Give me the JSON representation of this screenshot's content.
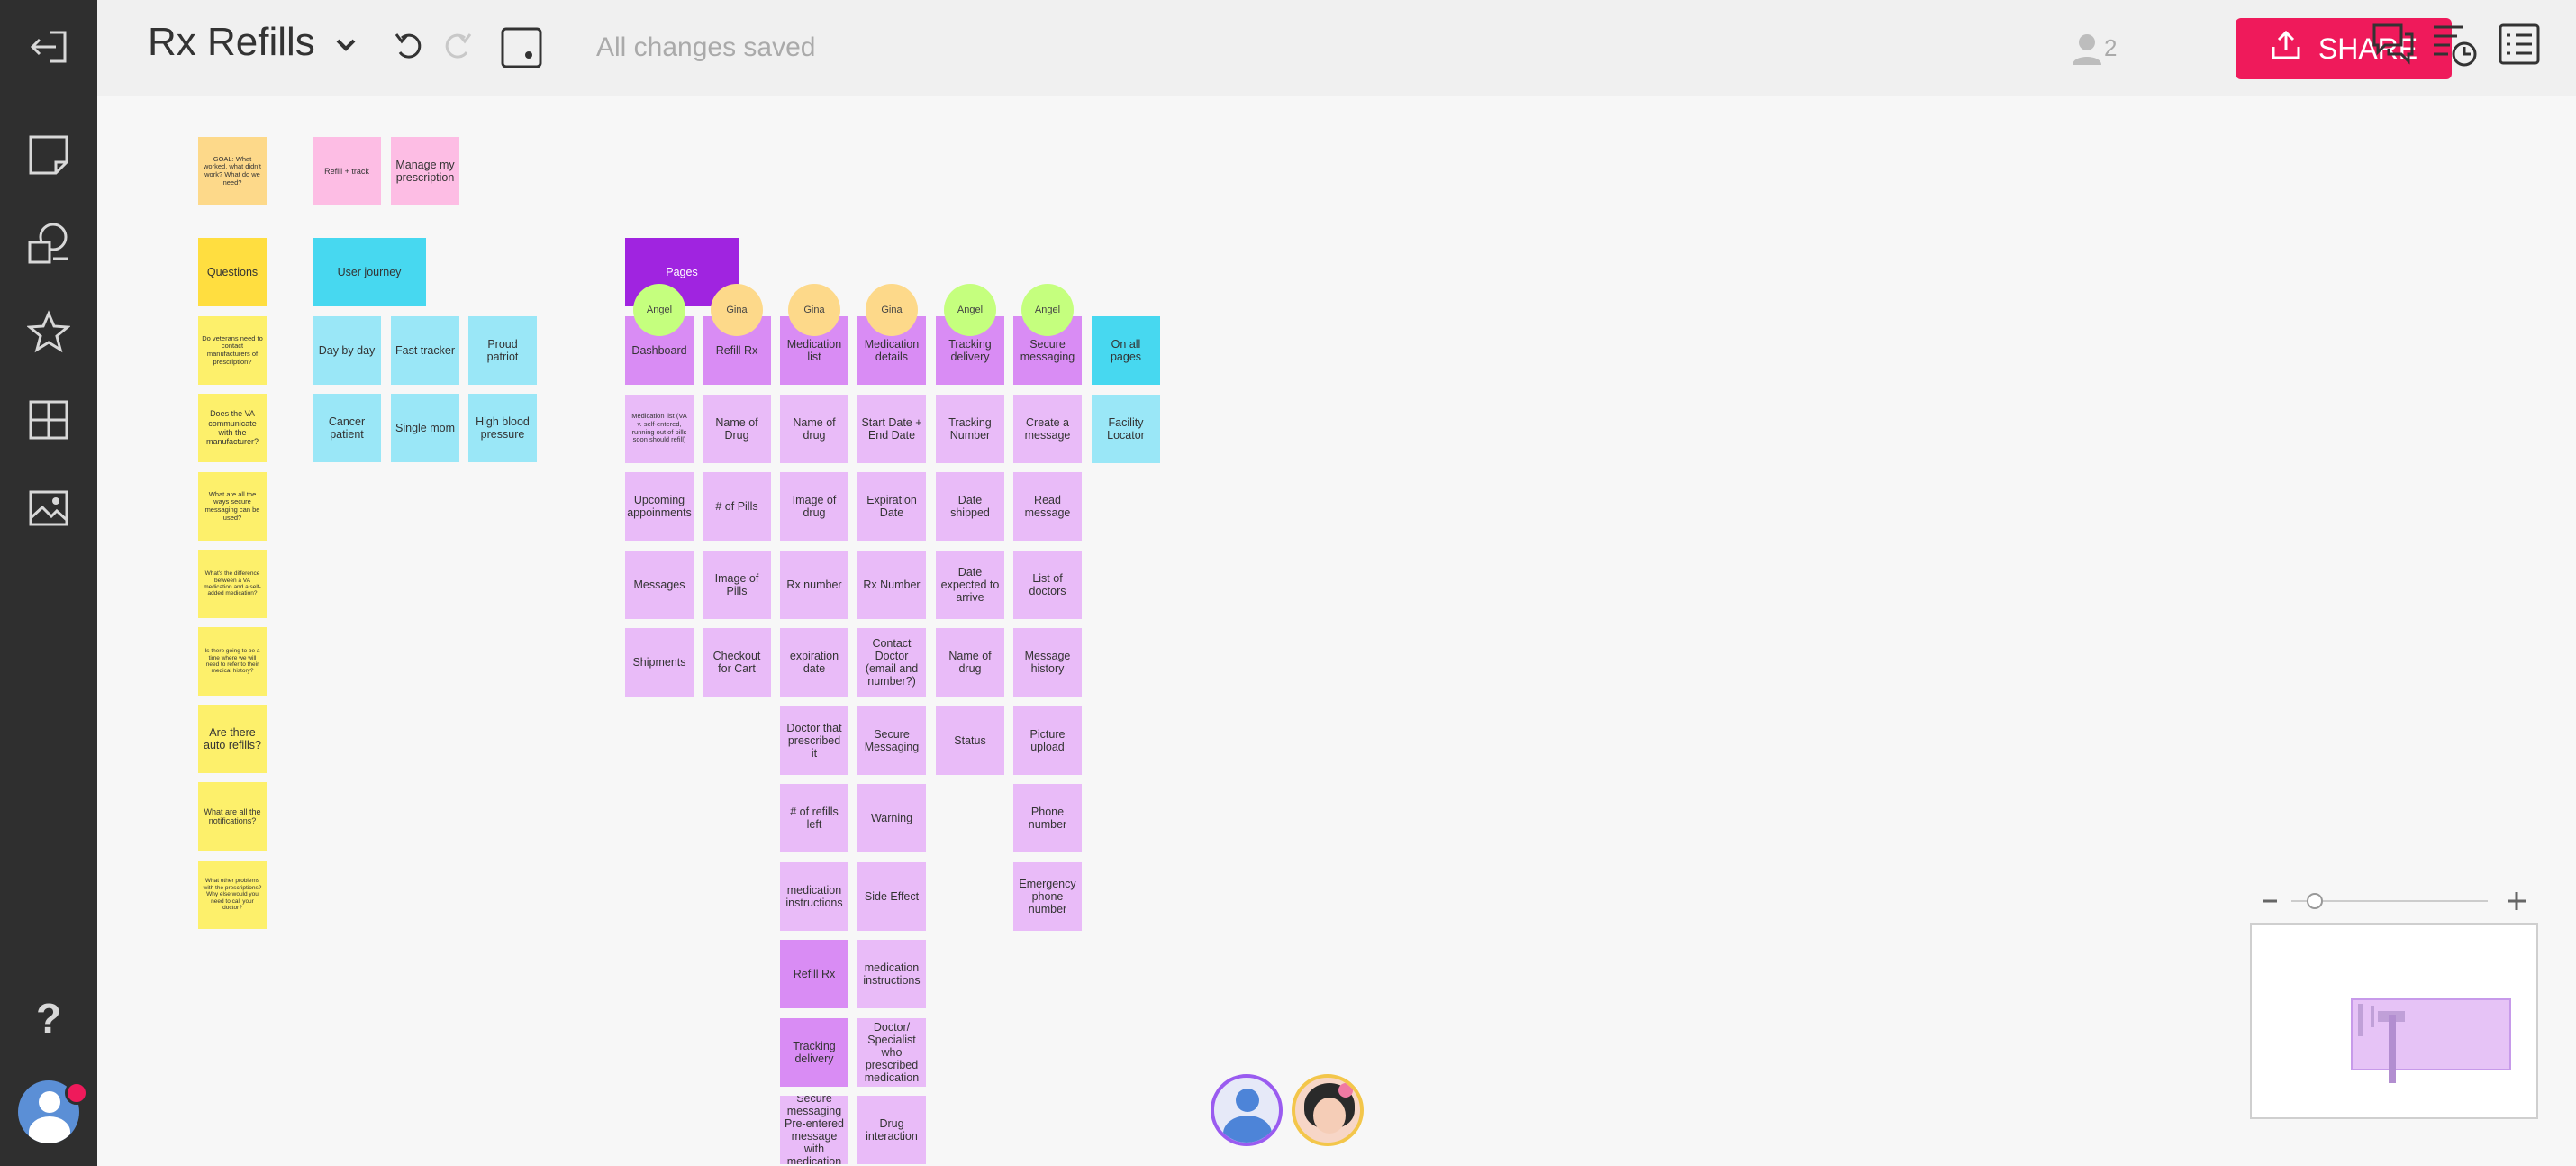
{
  "header": {
    "board_title": "Rx Refills",
    "saved_status": "All changes saved",
    "collaborator_count": "2",
    "share_label": "SHARE"
  },
  "colors": {
    "accent": "#ef1a5b",
    "sidebar": "#2f2f2f"
  },
  "icons": {
    "sidebar": [
      "exit-board-icon",
      "sticky-note-icon",
      "comment-shape-icon",
      "star-icon",
      "grid-template-icon",
      "image-icon",
      "help-icon",
      "user-avatar-icon"
    ],
    "toolbar": [
      "dropdown-chevron-icon",
      "undo-icon",
      "redo-icon",
      "frame-icon",
      "collaborators-icon",
      "share-upload-icon",
      "comments-icon",
      "history-icon",
      "outline-list-icon"
    ]
  },
  "sidebar": {
    "help_label": "?"
  },
  "notes": {
    "goal": "GOAL: What worked, what didn't work? What do we need?",
    "refill_track": "Refill + track",
    "manage_rx": "Manage my prescription",
    "questions": "Questions",
    "q1": "Do veterans need to contact manufacturers of prescription?",
    "q2": "Does the VA communicate with the manufacturer?",
    "q3": "What are all the ways secure messaging can be used?",
    "q4": "What's the difference between a VA medication and a self-added medication?",
    "q5": "Is there going to be a time where we will need to refer to their medical history?",
    "q6": "Are there auto refills?",
    "q7": "What are all the notifications?",
    "q8": "What other problems with the prescriptions? Why else would you need to call your doctor?",
    "user_journey": "User journey",
    "day_by_day": "Day by day",
    "fast_tracker": "Fast tracker",
    "proud_patriot": "Proud patriot",
    "cancer_patient": "Cancer patient",
    "single_mom": "Single mom",
    "high_bp": "High blood pressure",
    "pages": "Pages"
  },
  "page_columns": [
    {
      "header": "Dashboard",
      "owner": "Angel",
      "items": [
        "Medication list (VA v. self-entered, running out of pills soon should refill)",
        "Upcoming appoinments",
        "Messages",
        "Shipments"
      ]
    },
    {
      "header": "Refill Rx",
      "owner": "Gina",
      "items": [
        "Name of Drug",
        "# of Pills",
        "Image of Pills",
        "Checkout for Cart"
      ]
    },
    {
      "header": "Medication list",
      "owner": "Gina",
      "items": [
        "Name of drug",
        "Image of drug",
        "Rx number",
        "expiration date",
        "Doctor that prescribed it",
        "# of refills left",
        "medication instructions",
        "Refill Rx",
        "Tracking delivery",
        "Secure messaging Pre-entered message with medication"
      ]
    },
    {
      "header": "Medication details",
      "owner": "Gina",
      "items": [
        "Start Date + End Date",
        "Expiration Date",
        "Rx Number",
        "Contact Doctor (email and number?)",
        "Secure Messaging",
        "Warning",
        "Side Effect",
        "medication instructions",
        "Doctor/ Specialist who prescribed medication",
        "Drug interaction"
      ]
    },
    {
      "header": "Tracking delivery",
      "owner": "Angel",
      "items": [
        "Tracking Number",
        "Date shipped",
        "Date expected to arrive",
        "Name of drug",
        "Status"
      ]
    },
    {
      "header": "Secure messaging",
      "owner": "Angel",
      "items": [
        "Create a message",
        "Read message",
        "List of doctors",
        "Message history",
        "Picture upload",
        "Phone number",
        "Emergency phone number"
      ]
    },
    {
      "header": "On all pages",
      "owner": "",
      "items": [
        "Facility Locator"
      ]
    }
  ]
}
